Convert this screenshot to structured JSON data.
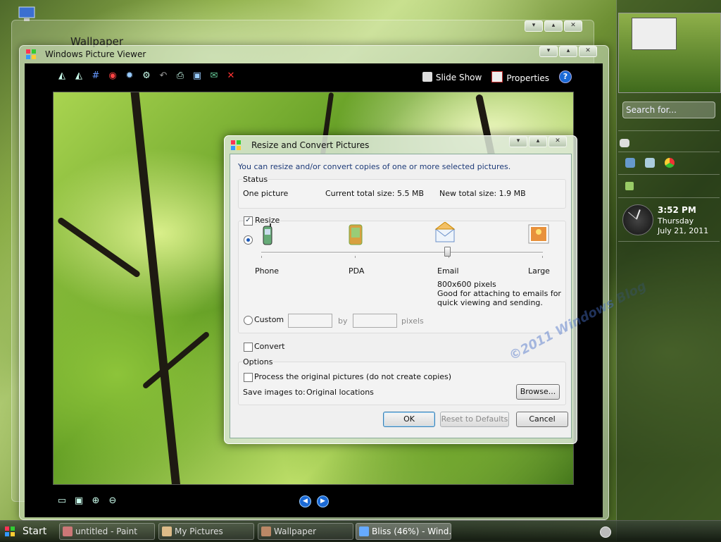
{
  "background_window": {
    "title": "Wallpaper"
  },
  "viewer": {
    "title": "Windows Picture Viewer",
    "slideshow_label": "Slide Show",
    "properties_label": "Properties",
    "help_label": "?"
  },
  "dialog": {
    "title": "Resize and Convert Pictures",
    "intro": "You can resize and/or convert copies of one or more selected pictures.",
    "status": {
      "label": "Status",
      "count": "One picture",
      "current_size": "Current total size:  5.5 MB",
      "new_size": "New total size:   1.9 MB"
    },
    "resize": {
      "label": "Resize",
      "checked": true,
      "presets": [
        "Phone",
        "PDA",
        "Email",
        "Large"
      ],
      "selected_preset": "Email",
      "desc_line1": "800x600 pixels",
      "desc_line2": "Good for attaching to emails for",
      "desc_line3": "quick viewing and sending.",
      "custom_label": "Custom",
      "by_label": "by",
      "pixels_label": "pixels"
    },
    "convert": {
      "label": "Convert",
      "checked": false
    },
    "options": {
      "label": "Options",
      "process_original": "Process the original pictures (do not create copies)",
      "save_to_label": "Save images to:",
      "save_to_value": "Original locations",
      "browse_label": "Browse..."
    },
    "buttons": {
      "ok": "OK",
      "reset": "Reset to Defaults",
      "cancel": "Cancel"
    }
  },
  "sidebar": {
    "search_placeholder": "Search for...",
    "time": "3:52 PM",
    "day": "Thursday",
    "date": "July 21, 2011"
  },
  "taskbar": {
    "start_label": "Start",
    "tasks": [
      "untitled - Paint",
      "My Pictures",
      "Wallpaper",
      "Bliss (46%) - Wind..."
    ],
    "active_index": 3
  },
  "watermark": "©2011 Windows Blog"
}
